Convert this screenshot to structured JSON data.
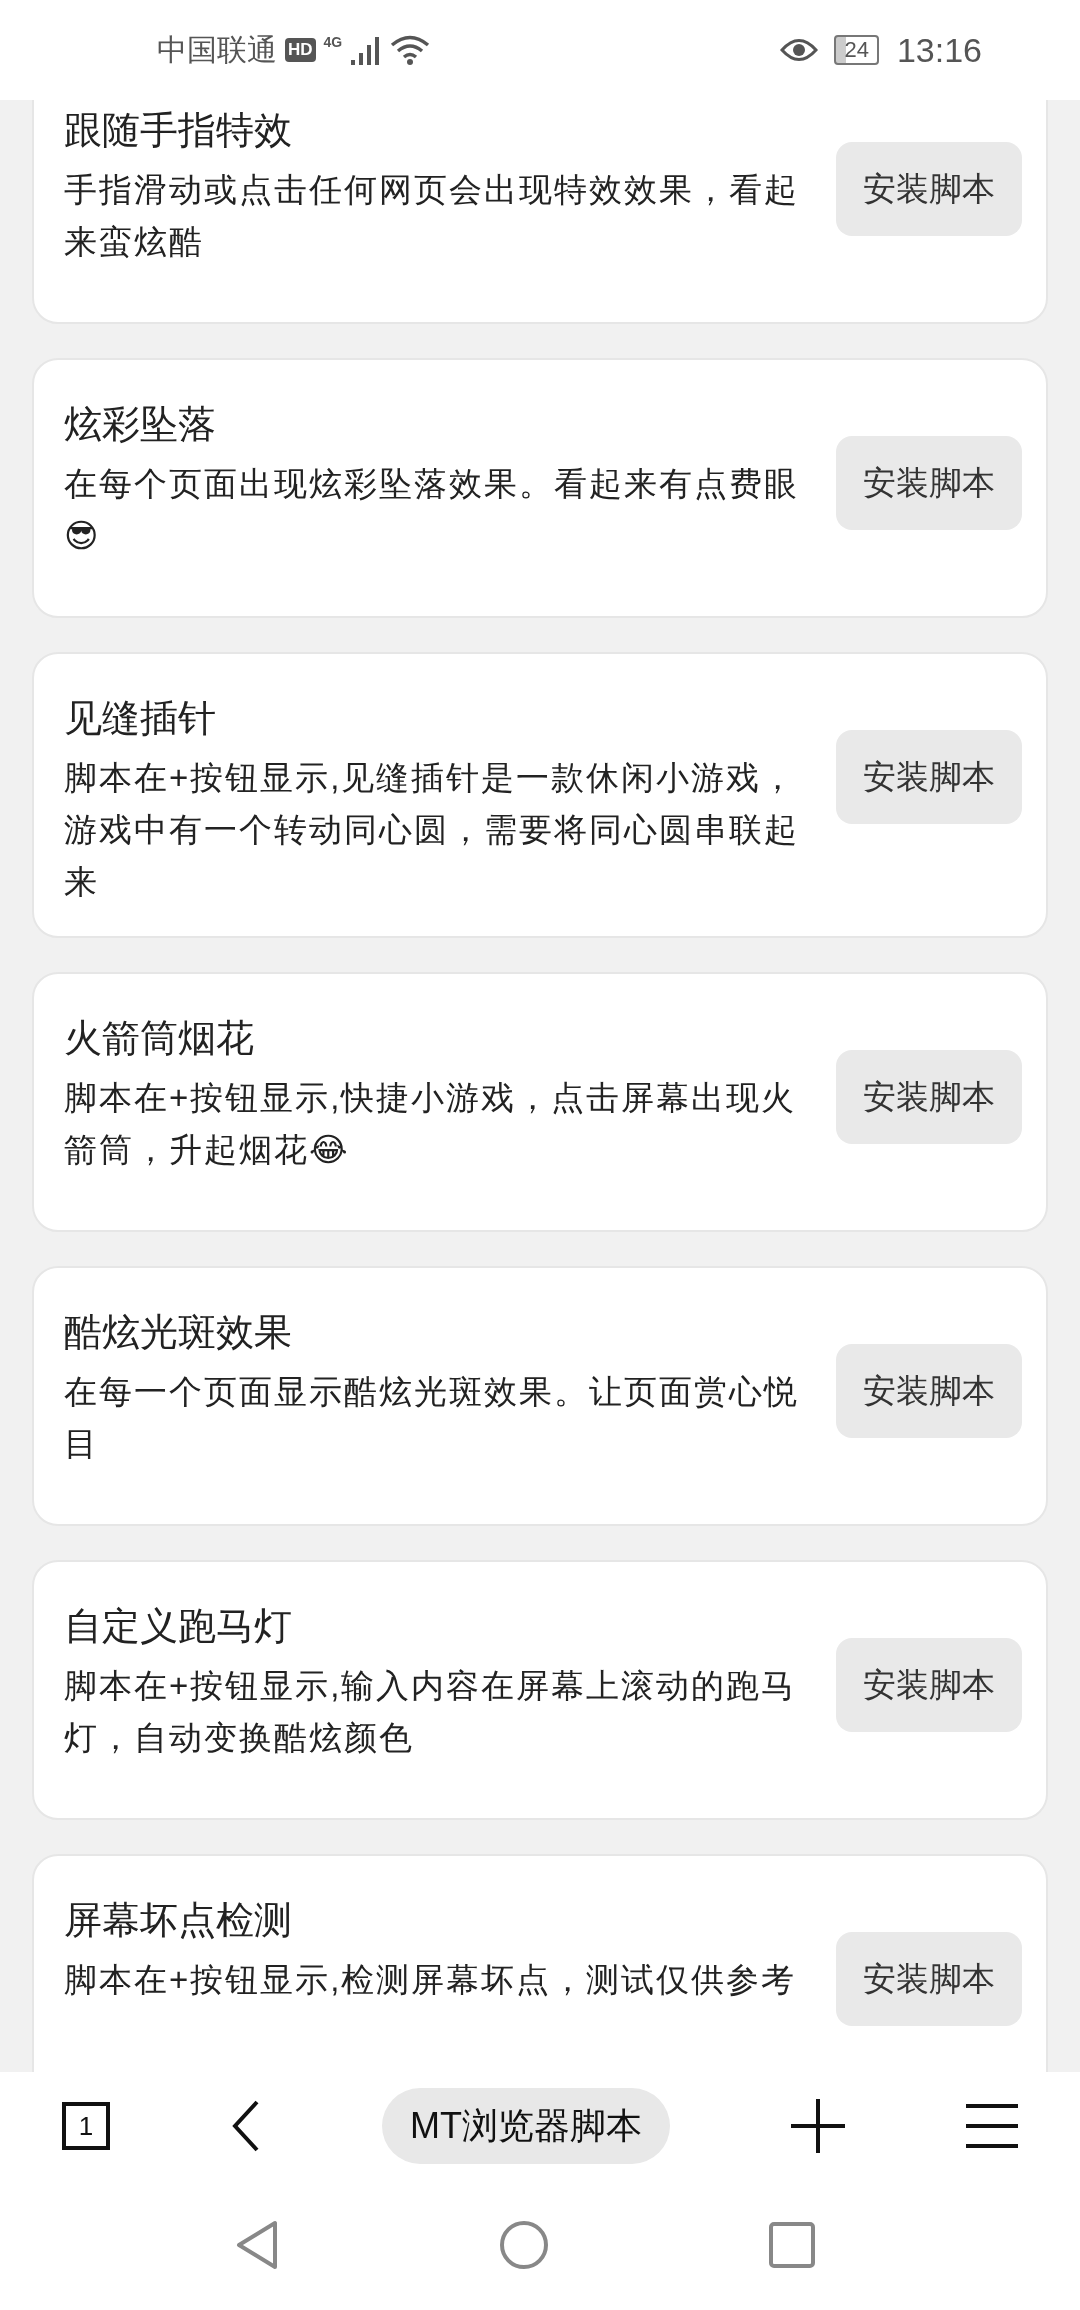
{
  "status_bar": {
    "carrier": "中国联通",
    "network_badge": "HD",
    "network_type": "4G",
    "battery": "24",
    "time": "13:16"
  },
  "scripts": [
    {
      "title": "跟随手指特效",
      "description": "手指滑动或点击任何网页会出现特效效果，看起来蛮炫酷",
      "button": "安装脚本"
    },
    {
      "title": "炫彩坠落",
      "description": "在每个页面出现炫彩坠落效果。看起来有点费眼😎",
      "button": "安装脚本"
    },
    {
      "title": "见缝插针",
      "description": "脚本在+按钮显示,见缝插针是一款休闲小游戏，游戏中有一个转动同心圆，需要将同心圆串联起来",
      "button": "安装脚本"
    },
    {
      "title": "火箭筒烟花",
      "description": "脚本在+按钮显示,快捷小游戏，点击屏幕出现火箭筒，升起烟花😂",
      "button": "安装脚本"
    },
    {
      "title": "酷炫光斑效果",
      "description": "在每一个页面显示酷炫光斑效果。让页面赏心悦目",
      "button": "安装脚本"
    },
    {
      "title": "自定义跑马灯",
      "description": "脚本在+按钮显示,输入内容在屏幕上滚动的跑马灯，自动变换酷炫颜色",
      "button": "安装脚本"
    },
    {
      "title": "屏幕坏点检测",
      "description": "脚本在+按钮显示,检测屏幕坏点，测试仅供参考",
      "button": "安装脚本"
    }
  ],
  "toolbar": {
    "tab_count": "1",
    "address": "MT浏览器脚本"
  }
}
